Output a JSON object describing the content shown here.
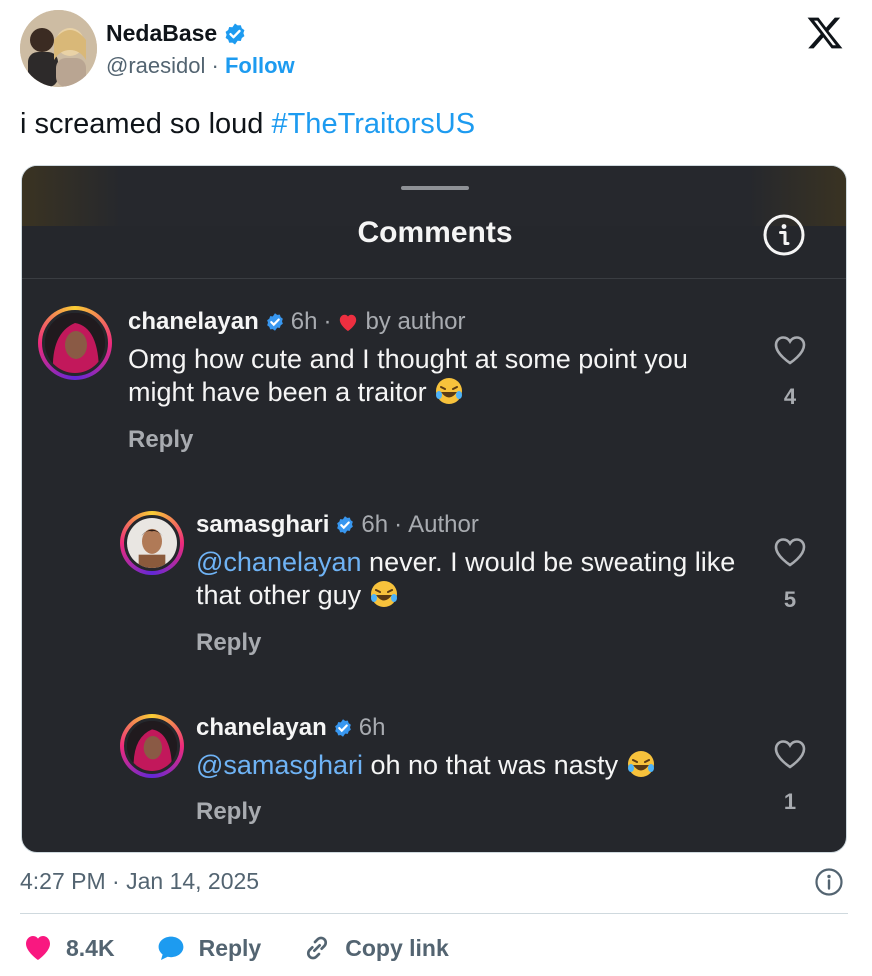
{
  "author": {
    "display_name": "NedaBase",
    "handle": "@raesidol",
    "separator": "·",
    "follow_label": "Follow",
    "verified": true
  },
  "tweet": {
    "text": "i screamed so loud",
    "hashtag": "#TheTraitorsUS"
  },
  "embedded": {
    "title": "Comments",
    "comments": [
      {
        "username": "chanelayan",
        "time": "6h",
        "sep": "·",
        "badge": "by author",
        "body_text": "Omg how cute and I thought at some point you might have been a traitor",
        "reply_label": "Reply",
        "likes": "4"
      },
      {
        "username": "samasghari",
        "time": "6h",
        "sep": "·",
        "badge": "Author",
        "mention": "@chanelayan",
        "body_text": "never. I would be sweating like that other guy",
        "reply_label": "Reply",
        "likes": "5"
      },
      {
        "username": "chanelayan",
        "time": "6h",
        "mention": "@samasghari",
        "body_text": "oh no that was nasty",
        "reply_label": "Reply",
        "likes": "1"
      }
    ]
  },
  "footer": {
    "timestamp": "4:27 PM · Jan 14, 2025",
    "like_count": "8.4K",
    "reply_label": "Reply",
    "copy_link_label": "Copy link"
  },
  "colors": {
    "link": "#1d9bf0",
    "like": "#f91880",
    "dark_bg": "#25272c"
  }
}
